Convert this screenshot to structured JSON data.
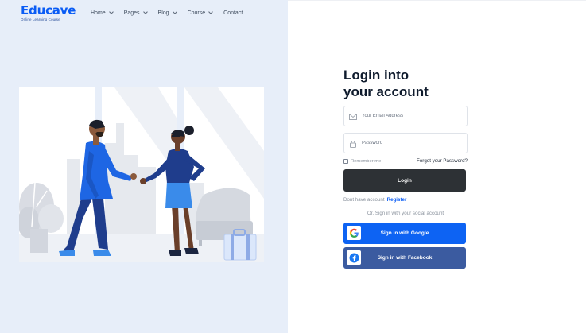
{
  "brand": {
    "name": "Educave",
    "tagline": "Online Learning Course"
  },
  "nav": {
    "items": [
      {
        "label": "Home",
        "has_dropdown": true
      },
      {
        "label": "Pages",
        "has_dropdown": true
      },
      {
        "label": "Blog",
        "has_dropdown": true
      },
      {
        "label": "Course",
        "has_dropdown": true
      },
      {
        "label": "Contact",
        "has_dropdown": false
      }
    ]
  },
  "login": {
    "title_line1": "Login into",
    "title_line2": "your account",
    "email_placeholder": "Your Email Address",
    "password_placeholder": "Password",
    "remember_label": "Remember me",
    "forgot_label": "Forgot your Password?",
    "submit_label": "Login",
    "no_account_text": "Dont have account",
    "register_label": "Register",
    "social_divider": "Or, Sign in with your social account",
    "google_label": "Sign in with Google",
    "facebook_label": "Sign in with Facebook"
  },
  "colors": {
    "brand_blue": "#0a5cf5",
    "left_panel_bg": "#e7eef9",
    "login_button": "#2d3135",
    "google_button": "#0d63f3",
    "facebook_button": "#3b5ba0"
  }
}
